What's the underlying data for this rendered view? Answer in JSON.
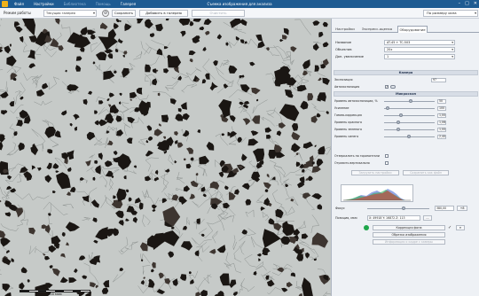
{
  "titlebar": {
    "menu": [
      "Файл",
      "Настройки",
      "Библиотека",
      "Помощь",
      "Галерея"
    ],
    "window_title": "Съемка изображения для анализа",
    "minimize": "–",
    "maximize": "□",
    "close": "✕"
  },
  "toolbar": {
    "mode_label": "Режим работы",
    "mode_value": "Текущая галерея",
    "save": "Сохранить",
    "add_to_gallery": "Добавить в галерею",
    "clear": "Очистить",
    "size_mode": "По размеру окна"
  },
  "image": {
    "scale_label": "300 мкм"
  },
  "panel": {
    "tabs": [
      "Настройки",
      "Экспресс-оценка",
      "Оборудование"
    ],
    "active_tab": 2,
    "fields": [
      {
        "label": "Название",
        "value": "AT-45 + TC-503"
      },
      {
        "label": "Объектив",
        "value": "20x"
      },
      {
        "label": "Доп. увеличение",
        "value": "1"
      }
    ],
    "camera_section": "Камера",
    "exposure_label": "Экспозиция",
    "exposure_value": "97",
    "auto_exposure_label": "Автоэкспозиция",
    "microscope_section": "Микроскоп",
    "sliders": [
      {
        "label": "Уровень автоэкспозиции, %",
        "value": "50",
        "level": 0.5
      },
      {
        "label": "Усиление",
        "value": "100",
        "level": 0.03
      },
      {
        "label": "Гамма-коррекция",
        "value": "1,00",
        "level": 0.3
      },
      {
        "label": "Уровень красного",
        "value": "1,06",
        "level": 0.26
      },
      {
        "label": "Уровень зеленого",
        "value": "1,00",
        "level": 0.26
      },
      {
        "label": "Уровень синего",
        "value": "2,40",
        "level": 0.48
      }
    ],
    "flip_h_label": "Отзеркалить по горизонтали",
    "flip_v_label": "Отразить вертикально",
    "restore_settings": "Загрузить настройки",
    "save_settings": "Сохранить как файл",
    "focus_label": "Фокус",
    "focus_value": "380,00",
    "focus_step": "+8",
    "position_label": "Позиция, мкм",
    "position_value": "X: 49918    Y: 16872    Z: 113",
    "position_btn": "...",
    "correct_btn": "Коррекция фона",
    "capture_btn": "Обрезка изображения",
    "info_btn": "Информация о кадре с камеры"
  },
  "colors": {
    "titlebar": "#1e5b92",
    "panel": "#eef1f5",
    "accent_green": "#1fa64a",
    "grain_dark": "#1a1613"
  }
}
